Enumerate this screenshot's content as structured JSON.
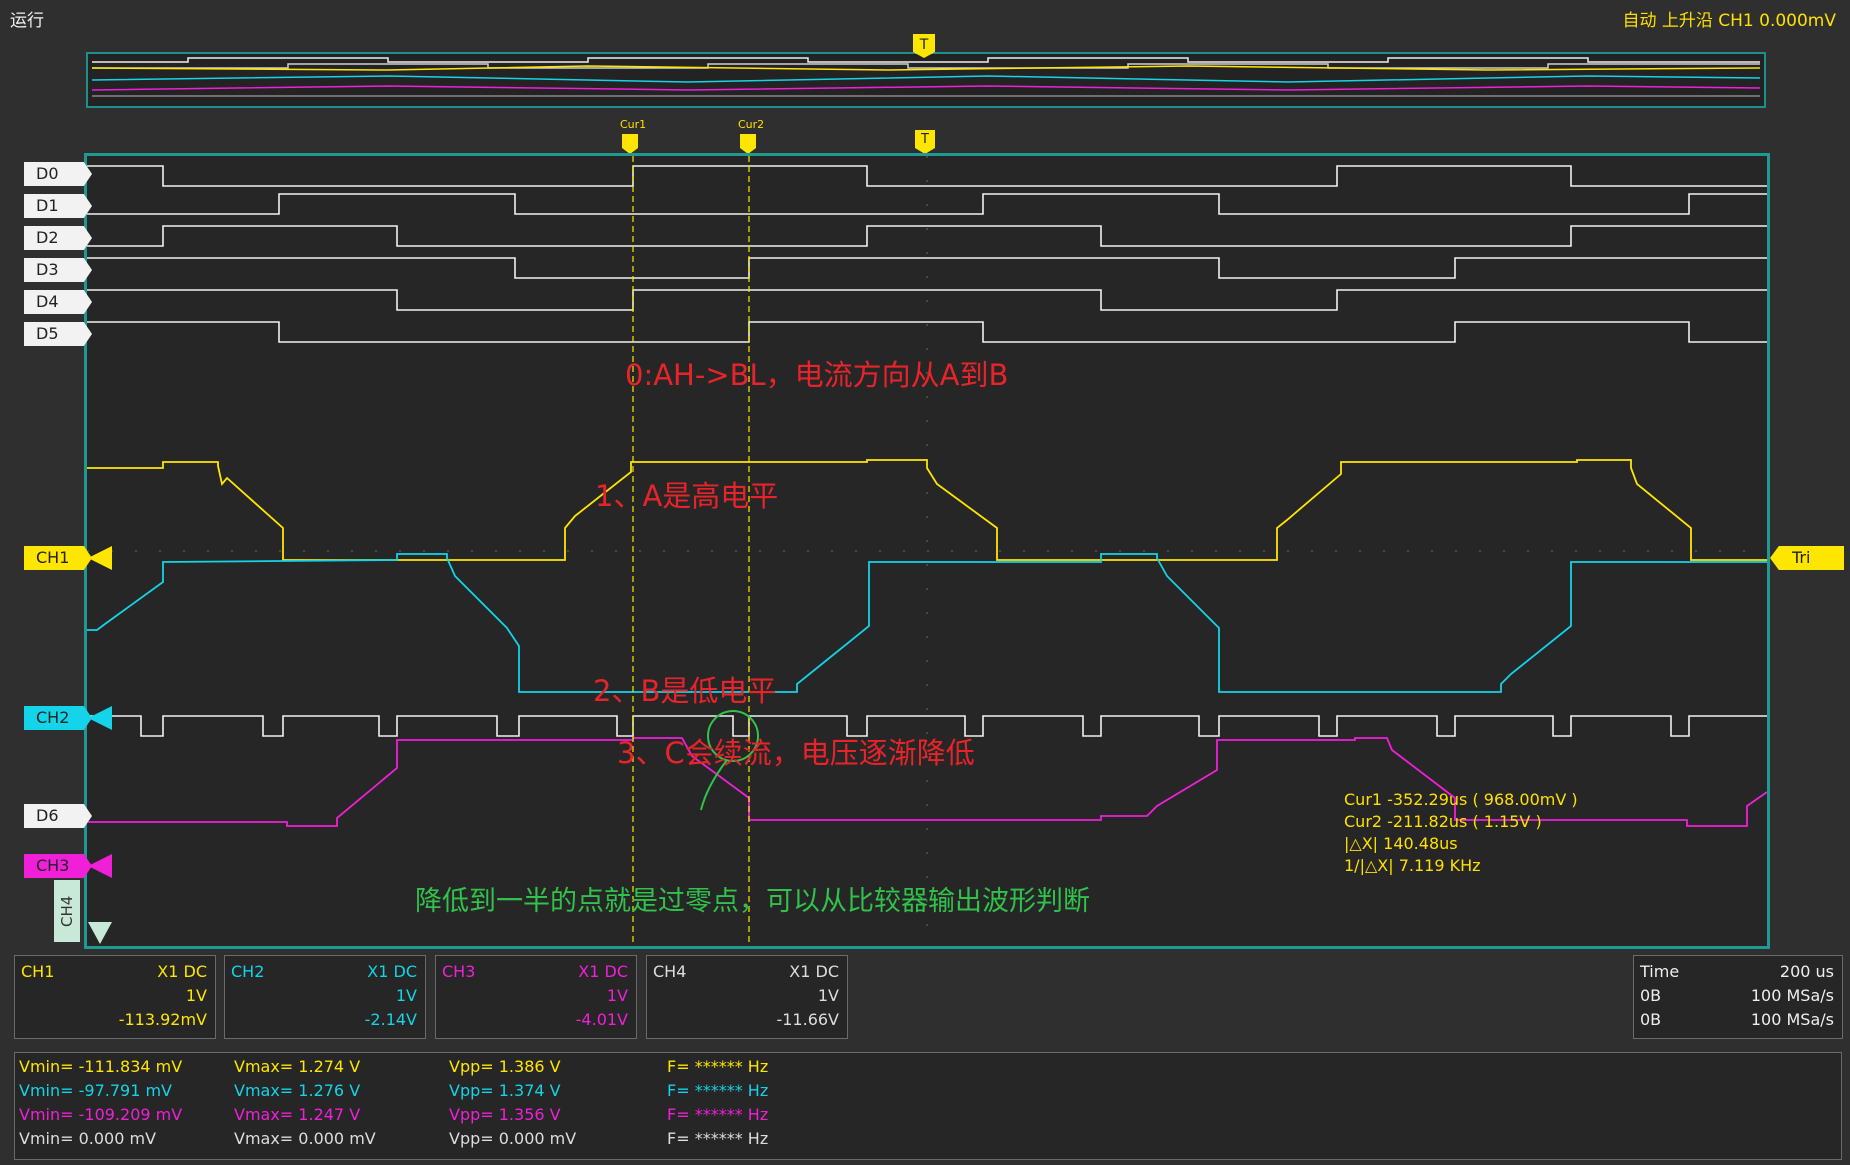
{
  "status": {
    "run_state": "运行",
    "trigger_info": "自动 上升沿 CH1 0.000mV"
  },
  "trigger_marker": "T",
  "cursor_labels": {
    "cur1": "Cur1",
    "cur2": "Cur2"
  },
  "digital_labels": [
    "D0",
    "D1",
    "D2",
    "D3",
    "D4",
    "D5",
    "D6"
  ],
  "analog_labels": {
    "ch1": "CH1",
    "ch2": "CH2",
    "ch3": "CH3",
    "ch4": "CH4",
    "trigger": "Tri"
  },
  "colors": {
    "ch1": "#ffe600",
    "ch2": "#13d4e8",
    "ch3": "#f01fd8",
    "ch4": "#dddddd",
    "grid_border": "#1e9a92"
  },
  "annotations": {
    "a0": "0:AH->BL，电流方向从A到B",
    "a1": "1、A是高电平",
    "a2": "2、B是低电平",
    "a3": "3、C会续流，电压逐渐降低",
    "a4": "降低到一半的点就是过零点，可以从比较器输出波形判断"
  },
  "cursor_readout": {
    "cur1": "Cur1   -352.29us ( 968.00mV )",
    "cur2": "Cur2   -211.82us ( 1.15V )",
    "dx": "|△X|   140.48us",
    "inv_dx": "1/|△X| 7.119 KHz"
  },
  "channels": [
    {
      "name": "CH1",
      "probe": "X1  DC",
      "scale": "1V",
      "offset": "-113.92mV",
      "color": "#ffe600"
    },
    {
      "name": "CH2",
      "probe": "X1  DC",
      "scale": "1V",
      "offset": "-2.14V",
      "color": "#13d4e8"
    },
    {
      "name": "CH3",
      "probe": "X1  DC",
      "scale": "1V",
      "offset": "-4.01V",
      "color": "#f01fd8"
    },
    {
      "name": "CH4",
      "probe": "X1  DC",
      "scale": "1V",
      "offset": "-11.66V",
      "color": "#dddddd"
    }
  ],
  "timebase": {
    "time_label": "Time",
    "time_value": "200 us",
    "row2_label": "0B",
    "row2_value": "100 MSa/s",
    "row3_label": "0B",
    "row3_value": "100 MSa/s"
  },
  "measurements": [
    {
      "vmin": "Vmin= -111.834 mV",
      "vmax": "Vmax= 1.274 V",
      "vpp": "Vpp= 1.386 V",
      "freq": "F= ****** Hz",
      "color": "#ffe600"
    },
    {
      "vmin": "Vmin= -97.791 mV",
      "vmax": "Vmax= 1.276 V",
      "vpp": "Vpp= 1.374 V",
      "freq": "F= ****** Hz",
      "color": "#13d4e8"
    },
    {
      "vmin": "Vmin= -109.209 mV",
      "vmax": "Vmax= 1.247 V",
      "vpp": "Vpp= 1.356 V",
      "freq": "F= ****** Hz",
      "color": "#f01fd8"
    },
    {
      "vmin": "Vmin= 0.000 mV",
      "vmax": "Vmax= 0.000 mV",
      "vpp": "Vpp= 0.000 mV",
      "freq": "F= ****** Hz",
      "color": "#dddddd"
    }
  ]
}
